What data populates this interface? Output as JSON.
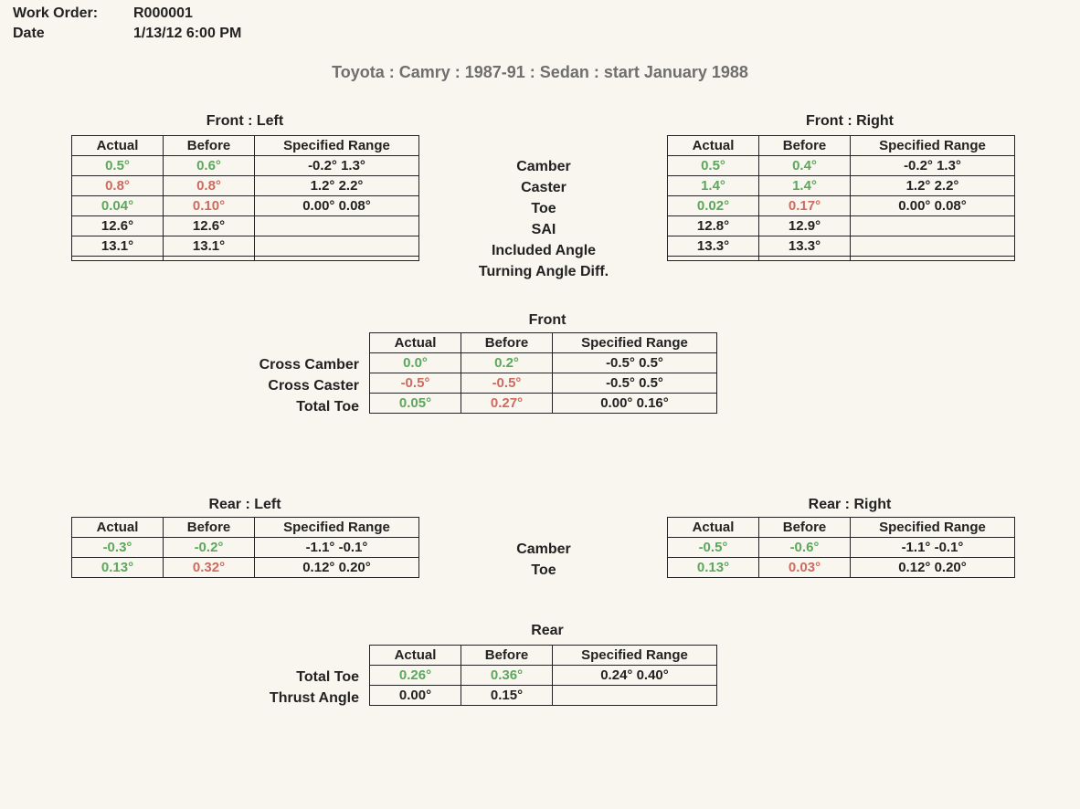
{
  "header": {
    "work_order_label": "Work Order:",
    "work_order_value": "R000001",
    "date_label": "Date",
    "date_value": "1/13/12 6:00 PM"
  },
  "title": "Toyota : Camry : 1987-91 : Sedan : start January 1988",
  "col_headers": {
    "actual": "Actual",
    "before": "Before",
    "range": "Specified Range"
  },
  "front": {
    "left_title": "Front : Left",
    "right_title": "Front : Right",
    "row_labels": [
      "Camber",
      "Caster",
      "Toe",
      "SAI",
      "Included Angle",
      "Turning Angle Diff."
    ],
    "left": [
      {
        "actual": "0.5°",
        "ac": "green",
        "before": "0.6°",
        "bc": "green",
        "range": "-0.2° 1.3°"
      },
      {
        "actual": "0.8°",
        "ac": "red",
        "before": "0.8°",
        "bc": "red",
        "range": "1.2° 2.2°"
      },
      {
        "actual": "0.04°",
        "ac": "green",
        "before": "0.10°",
        "bc": "red",
        "range": "0.00° 0.08°"
      },
      {
        "actual": "12.6°",
        "ac": "plain",
        "before": "12.6°",
        "bc": "plain",
        "range": ""
      },
      {
        "actual": "13.1°",
        "ac": "plain",
        "before": "13.1°",
        "bc": "plain",
        "range": ""
      },
      {
        "actual": "",
        "ac": "plain",
        "before": "",
        "bc": "plain",
        "range": ""
      }
    ],
    "right": [
      {
        "actual": "0.5°",
        "ac": "green",
        "before": "0.4°",
        "bc": "green",
        "range": "-0.2° 1.3°"
      },
      {
        "actual": "1.4°",
        "ac": "green",
        "before": "1.4°",
        "bc": "green",
        "range": "1.2° 2.2°"
      },
      {
        "actual": "0.02°",
        "ac": "green",
        "before": "0.17°",
        "bc": "red",
        "range": "0.00° 0.08°"
      },
      {
        "actual": "12.8°",
        "ac": "plain",
        "before": "12.9°",
        "bc": "plain",
        "range": ""
      },
      {
        "actual": "13.3°",
        "ac": "plain",
        "before": "13.3°",
        "bc": "plain",
        "range": ""
      },
      {
        "actual": "",
        "ac": "plain",
        "before": "",
        "bc": "plain",
        "range": ""
      }
    ]
  },
  "front_summary": {
    "title": "Front",
    "row_labels": [
      "Cross Camber",
      "Cross Caster",
      "Total Toe"
    ],
    "rows": [
      {
        "actual": "0.0°",
        "ac": "green",
        "before": "0.2°",
        "bc": "green",
        "range": "-0.5° 0.5°"
      },
      {
        "actual": "-0.5°",
        "ac": "red",
        "before": "-0.5°",
        "bc": "red",
        "range": "-0.5° 0.5°"
      },
      {
        "actual": "0.05°",
        "ac": "green",
        "before": "0.27°",
        "bc": "red",
        "range": "0.00° 0.16°"
      }
    ]
  },
  "rear": {
    "left_title": "Rear : Left",
    "right_title": "Rear : Right",
    "row_labels": [
      "Camber",
      "Toe"
    ],
    "left": [
      {
        "actual": "-0.3°",
        "ac": "green",
        "before": "-0.2°",
        "bc": "green",
        "range": "-1.1° -0.1°"
      },
      {
        "actual": "0.13°",
        "ac": "green",
        "before": "0.32°",
        "bc": "red",
        "range": "0.12° 0.20°"
      }
    ],
    "right": [
      {
        "actual": "-0.5°",
        "ac": "green",
        "before": "-0.6°",
        "bc": "green",
        "range": "-1.1° -0.1°"
      },
      {
        "actual": "0.13°",
        "ac": "green",
        "before": "0.03°",
        "bc": "red",
        "range": "0.12° 0.20°"
      }
    ]
  },
  "rear_summary": {
    "title": "Rear",
    "row_labels": [
      "Total Toe",
      "Thrust Angle"
    ],
    "rows": [
      {
        "actual": "0.26°",
        "ac": "green",
        "before": "0.36°",
        "bc": "green",
        "range": "0.24° 0.40°"
      },
      {
        "actual": "0.00°",
        "ac": "plain",
        "before": "0.15°",
        "bc": "plain",
        "range": ""
      }
    ]
  }
}
